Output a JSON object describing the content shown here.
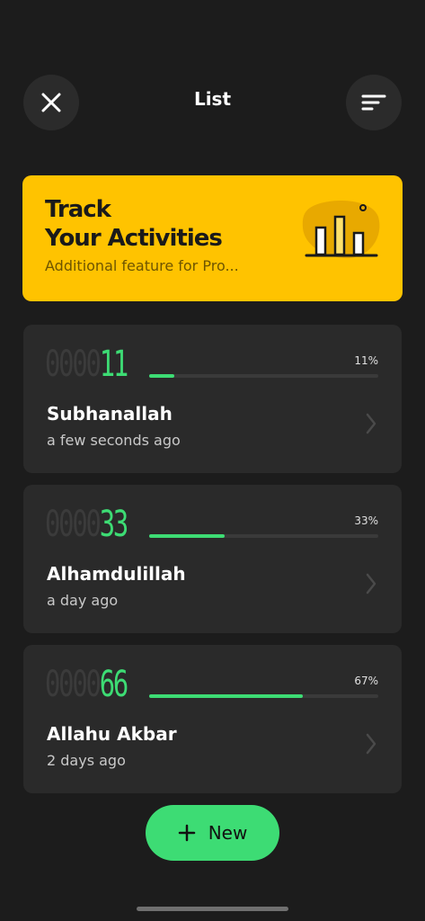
{
  "header": {
    "title": "List",
    "close_icon": "close-icon",
    "sort_icon": "sort-icon"
  },
  "promo": {
    "title_line1": "Track",
    "title_line2": "Your Activities",
    "subtitle": "Additional feature for Pro...",
    "icon": "bar-chart-icon",
    "background_color": "#ffc300"
  },
  "items": [
    {
      "counter_dim": "0000",
      "counter_lit": "11",
      "percent_label": "11%",
      "progress": 0.11,
      "name": "Subhanallah",
      "time": "a few seconds ago"
    },
    {
      "counter_dim": "0000",
      "counter_lit": "33",
      "percent_label": "33%",
      "progress": 0.33,
      "name": "Alhamdulillah",
      "time": "a day ago"
    },
    {
      "counter_dim": "0000",
      "counter_lit": "66",
      "percent_label": "67%",
      "progress": 0.67,
      "name": "Allahu Akbar",
      "time": "2 days ago"
    }
  ],
  "new_button": {
    "label": "New",
    "icon": "plus-icon"
  },
  "colors": {
    "accent": "#3ddc74",
    "background": "#1c1c1c",
    "card": "#2a2a2a",
    "promo": "#ffc300"
  }
}
